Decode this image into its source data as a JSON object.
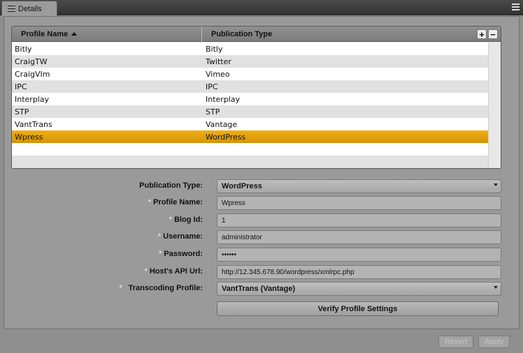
{
  "tab": {
    "label": "Details"
  },
  "grid": {
    "columns": [
      "Profile Name",
      "Publication Type"
    ],
    "rows": [
      {
        "name": "Bitly",
        "type": "Bitly"
      },
      {
        "name": "CraigTW",
        "type": "Twitter"
      },
      {
        "name": "CraigVIm",
        "type": "Vimeo"
      },
      {
        "name": "IPC",
        "type": "IPC"
      },
      {
        "name": "Interplay",
        "type": "Interplay"
      },
      {
        "name": "STP",
        "type": "STP"
      },
      {
        "name": "VantTrans",
        "type": "Vantage"
      },
      {
        "name": "Wpress",
        "type": "WordPress"
      }
    ],
    "selected_index": 7,
    "add_label": "+",
    "remove_label": "−"
  },
  "form": {
    "publication_type": {
      "label": "Publication Type:",
      "value": "WordPress"
    },
    "profile_name": {
      "label": "Profile Name:",
      "value": "Wpress"
    },
    "blog_id": {
      "label": "Blog Id:",
      "value": "1"
    },
    "username": {
      "label": "Username:",
      "value": "administrator"
    },
    "password": {
      "label": "Password:",
      "value": "••••••"
    },
    "api_url": {
      "label": "Host's API Url:",
      "value": "http://12.345.678.90/wordpress/xmlrpc.php"
    },
    "transcoding_profile": {
      "label": "Transcoding Profile:",
      "value": "VantTrans (Vantage)"
    },
    "required_marker": "*",
    "verify_label": "Verify Profile Settings"
  },
  "footer": {
    "revert_label": "Revert",
    "apply_label": "Apply"
  },
  "colors": {
    "selection": "#e8a30f",
    "panel": "#9a9a9a"
  }
}
